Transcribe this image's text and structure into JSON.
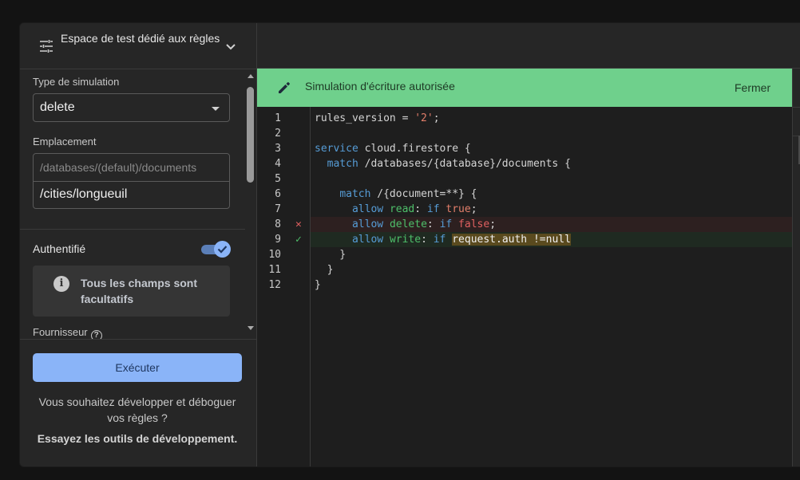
{
  "panel": {
    "title": "Espace de test dédié aux règles",
    "sim_type_label": "Type de simulation",
    "sim_type_value": "delete",
    "location_label": "Emplacement",
    "location_prefix": "/databases/(default)/documents",
    "location_value": "/cities/longueuil",
    "auth_label": "Authentifié",
    "auth_on": true,
    "info_text": "Tous les champs sont facultatifs",
    "provider_label": "Fournisseur",
    "run_label": "Exécuter",
    "promo_text": "Vous souhaitez développer et déboguer vos règles ?",
    "promo_link": "Essayez les outils de développement."
  },
  "banner": {
    "text": "Simulation d'écriture autorisée",
    "close_label": "Fermer",
    "color": "#6fd08c"
  },
  "editor": {
    "line_numbers": [
      "1",
      "2",
      "3",
      "4",
      "5",
      "6",
      "7",
      "8",
      "9",
      "10",
      "11",
      "12"
    ],
    "fail_mark": "✕",
    "pass_mark": "✓"
  }
}
